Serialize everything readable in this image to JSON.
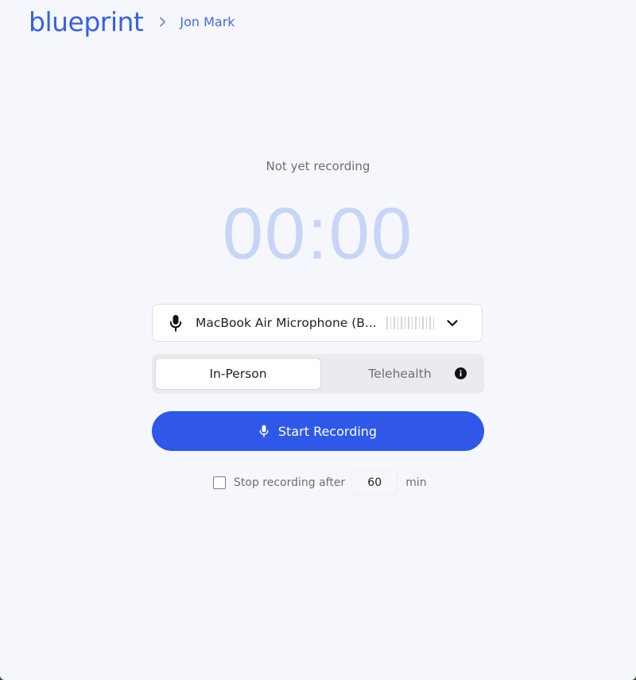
{
  "header": {
    "logo_text": "blueprint",
    "breadcrumb_client": "Jon Mark"
  },
  "recorder": {
    "status": "Not yet recording",
    "timer": "00:00"
  },
  "microphone": {
    "selected": "MacBook Air Microphone (B..."
  },
  "mode": {
    "options": [
      "In-Person",
      "Telehealth"
    ],
    "selected": "In-Person"
  },
  "actions": {
    "start_label": "Start Recording"
  },
  "auto_stop": {
    "label": "Stop recording after",
    "minutes": "60",
    "unit": "min",
    "checked": false
  },
  "icons": {
    "breadcrumb_separator": "chevron-right-icon",
    "microphone": "microphone-icon",
    "dropdown": "chevron-down-icon",
    "info": "info-icon"
  },
  "colors": {
    "brand": "#3760e6",
    "primary_button": "#2f58e8",
    "timer": "#c9d5f6",
    "background": "#f6f7fc"
  }
}
